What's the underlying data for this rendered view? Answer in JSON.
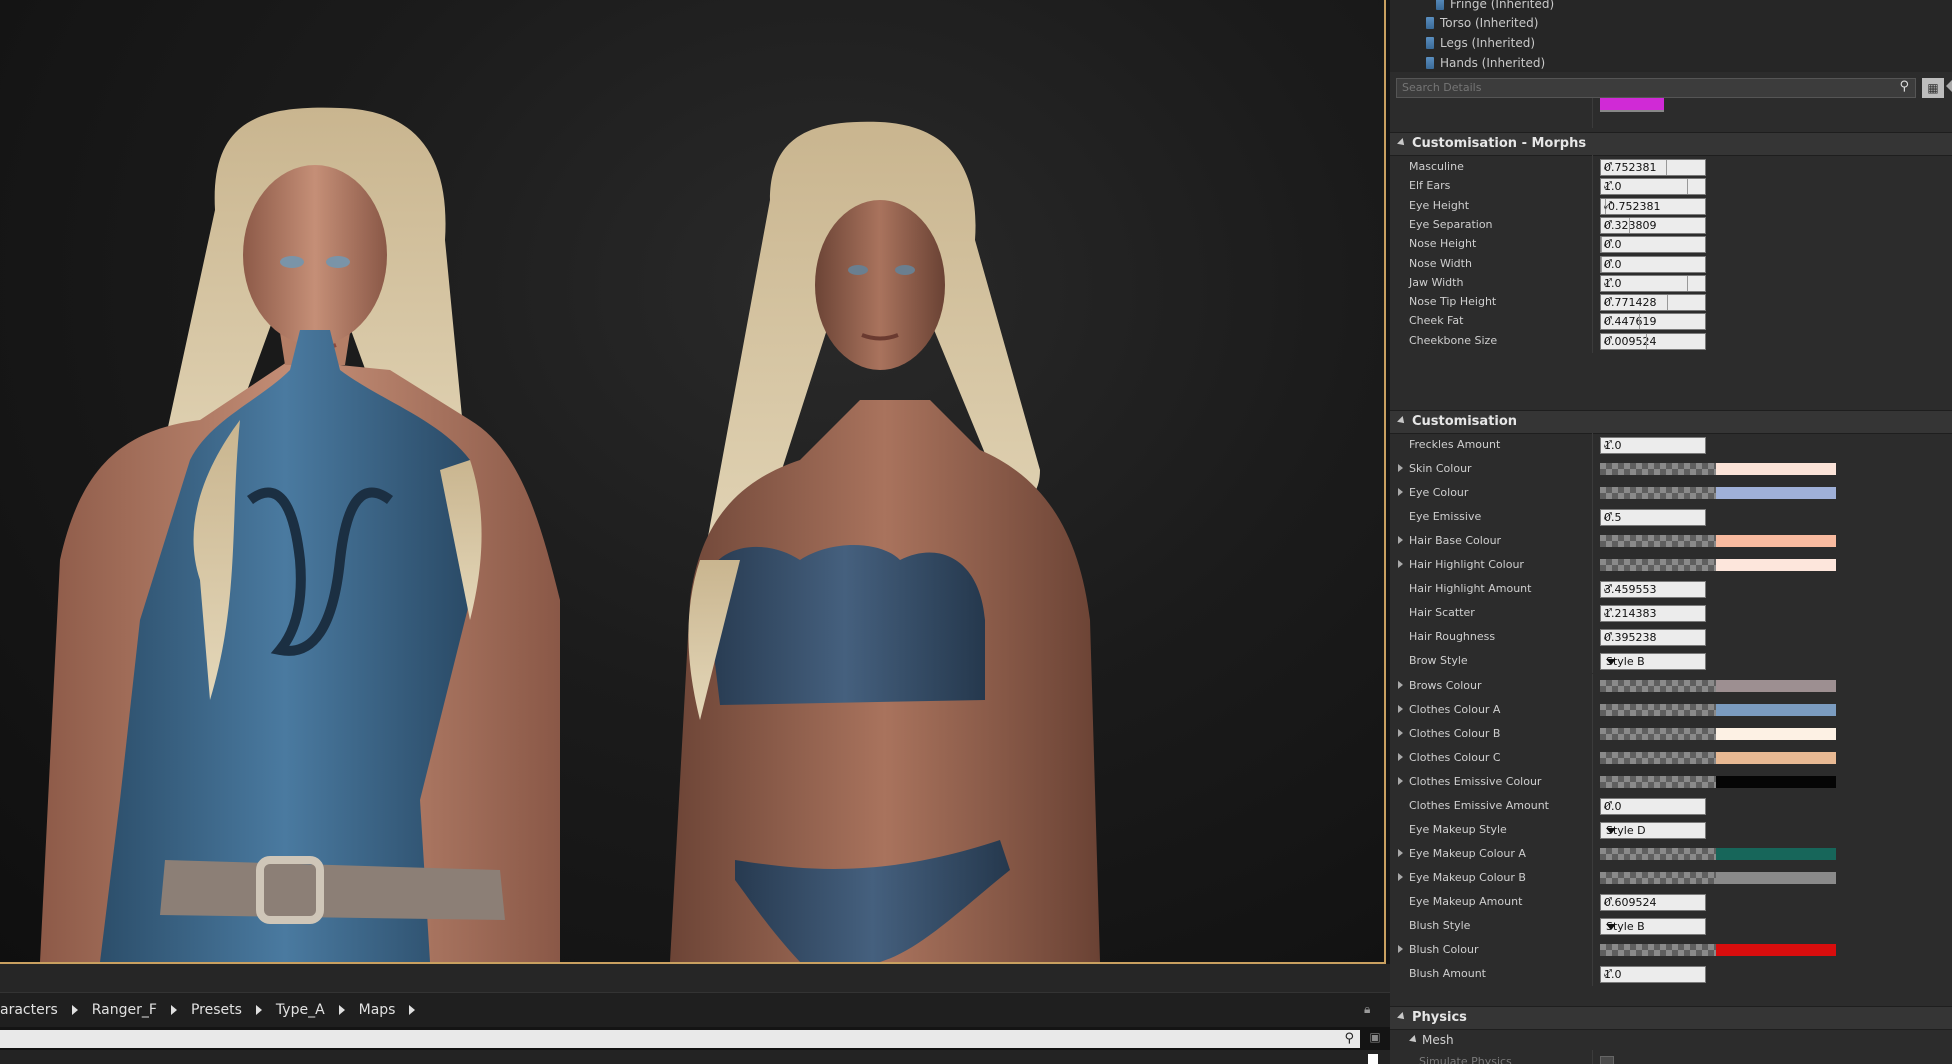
{
  "browser": {
    "crumbs": [
      "aracters",
      "Ranger_F",
      "Presets",
      "Type_A",
      "Maps"
    ]
  },
  "tree": {
    "items": [
      "Fringe (Inherited)",
      "Torso (Inherited)",
      "Legs (Inherited)",
      "Hands (Inherited)"
    ]
  },
  "details": {
    "search_placeholder": "Search Details"
  },
  "colors": {
    "accent_border": "#c9a060",
    "swatch_magenta": "#d02ad6"
  },
  "morphs": {
    "title": "Customisation - Morphs",
    "rows": [
      {
        "name": "Masculine",
        "value": "0.752381",
        "level": 0.752381
      },
      {
        "name": "Elf Ears",
        "value": "1.0",
        "level": 1.0
      },
      {
        "name": "Eye Height",
        "value": "-0.752381",
        "level": 0.05
      },
      {
        "name": "Eye Separation",
        "value": "0.323809",
        "level": 0.323809
      },
      {
        "name": "Nose Height",
        "value": "0.0",
        "level": 0.0
      },
      {
        "name": "Nose Width",
        "value": "0.0",
        "level": 0.0
      },
      {
        "name": "Jaw Width",
        "value": "1.0",
        "level": 1.0
      },
      {
        "name": "Nose Tip Height",
        "value": "0.771428",
        "level": 0.771428
      },
      {
        "name": "Cheek Fat",
        "value": "0.447619",
        "level": 0.447619
      },
      {
        "name": "Cheekbone Size",
        "value": "0.009524",
        "level": 0.52
      }
    ]
  },
  "custom": {
    "title": "Customisation",
    "rows": [
      {
        "name": "Freckles Amount",
        "type": "num",
        "value": "1.0"
      },
      {
        "name": "Skin Colour",
        "type": "color",
        "color": "#fbe3d8"
      },
      {
        "name": "Eye Colour",
        "type": "color",
        "color": "#9fb0d8"
      },
      {
        "name": "Eye Emissive",
        "type": "num",
        "value": "0.5"
      },
      {
        "name": "Hair Base Colour",
        "type": "color",
        "color": "#f9bba0"
      },
      {
        "name": "Hair Highlight Colour",
        "type": "color",
        "color": "#fde6dc"
      },
      {
        "name": "Hair Highlight Amount",
        "type": "num",
        "value": "3.459553"
      },
      {
        "name": "Hair Scatter",
        "type": "num",
        "value": "1.214383"
      },
      {
        "name": "Hair Roughness",
        "type": "num",
        "value": "0.395238"
      },
      {
        "name": "Brow Style",
        "type": "drop",
        "value": "Style B"
      },
      {
        "name": "Brows Colour",
        "type": "color",
        "color": "#9d8f91"
      },
      {
        "name": "Clothes Colour A",
        "type": "color",
        "color": "#7b9cc0"
      },
      {
        "name": "Clothes Colour B",
        "type": "color",
        "color": "#fdf1e4"
      },
      {
        "name": "Clothes Colour C",
        "type": "color",
        "color": "#e8b993"
      },
      {
        "name": "Clothes Emissive Colour",
        "type": "color",
        "color": "#050505"
      },
      {
        "name": "Clothes Emissive Amount",
        "type": "num",
        "value": "0.0"
      },
      {
        "name": "Eye Makeup Style",
        "type": "drop",
        "value": "Style D"
      },
      {
        "name": "Eye Makeup Colour A",
        "type": "color",
        "color": "#17665a"
      },
      {
        "name": "Eye Makeup Colour B",
        "type": "color",
        "color": "#8a8a8a"
      },
      {
        "name": "Eye Makeup Amount",
        "type": "num",
        "value": "0.609524"
      },
      {
        "name": "Blush Style",
        "type": "drop",
        "value": "Style B"
      },
      {
        "name": "Blush Colour",
        "type": "color",
        "color": "#d90d0d"
      },
      {
        "name": "Blush Amount",
        "type": "num",
        "value": "1.0"
      }
    ]
  },
  "physics": {
    "title": "Physics",
    "sub": "Mesh",
    "row": "Simulate Physics"
  }
}
